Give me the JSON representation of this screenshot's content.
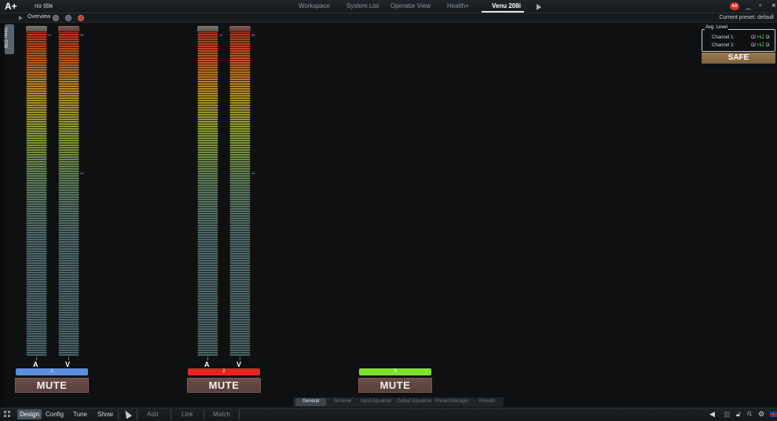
{
  "topbar": {
    "logo": "A+",
    "doc_title": "no title",
    "tabs": [
      {
        "label": "Workspace",
        "active": false
      },
      {
        "label": "System List",
        "active": false
      },
      {
        "label": "Operator View",
        "active": false
      },
      {
        "label": "Health+",
        "active": false
      },
      {
        "label": "Venu 208i",
        "active": true
      }
    ],
    "user_initials": "AA",
    "window_controls": [
      "_",
      "▫",
      "×"
    ]
  },
  "subbar": {
    "overview_label": "Overview",
    "preset_label": "Current preset: default"
  },
  "side_tab": {
    "label": "Venu 208i"
  },
  "channels": [
    {
      "number": "1",
      "color": "#5b8fe0",
      "mute_label": "MUTE",
      "meters": [
        {
          "label": "A",
          "scale_top": "12",
          "scale_mid": ""
        },
        {
          "label": "V",
          "scale_top": "38",
          "scale_mid": "25"
        }
      ]
    },
    {
      "number": "2",
      "color": "#e3261d",
      "mute_label": "MUTE",
      "meters": [
        {
          "label": "A",
          "scale_top": "12",
          "scale_mid": ""
        },
        {
          "label": "V",
          "scale_top": "38",
          "scale_mid": "25"
        }
      ]
    },
    {
      "number": "3",
      "color": "#7ee02e",
      "mute_label": "MUTE",
      "meters": []
    }
  ],
  "avg_level": {
    "title": "Avg. Level",
    "rows": [
      {
        "label": "Channel 1:",
        "prefix": "Ω/",
        "hz": "HiZ",
        "suffix": "Ω"
      },
      {
        "label": "Channel 2:",
        "prefix": "Ω/",
        "hz": "HiZ",
        "suffix": "Ω"
      }
    ],
    "safe_label": "SAFE"
  },
  "section_tabs": [
    {
      "label": "General",
      "active": true
    },
    {
      "label": "Scheme",
      "active": false
    },
    {
      "label": "Input Equalizer",
      "active": false
    },
    {
      "label": "Output Equalizer",
      "active": false
    },
    {
      "label": "Preset Manager",
      "active": false
    },
    {
      "label": "Presets",
      "active": false
    }
  ],
  "bottombar": {
    "modes": [
      {
        "label": "Design",
        "active": true
      },
      {
        "label": "Config",
        "active": false
      },
      {
        "label": "Tune",
        "active": false
      },
      {
        "label": "Show",
        "active": false
      }
    ],
    "tools": [
      "Add",
      "Link",
      "Match"
    ],
    "page_indicator": "/1",
    "icons": [
      "grid-icon",
      "pointer-icon",
      "speaker-icon",
      "trash-icon",
      "unlock-icon",
      "gear-icon",
      "uk-flag-icon"
    ]
  }
}
